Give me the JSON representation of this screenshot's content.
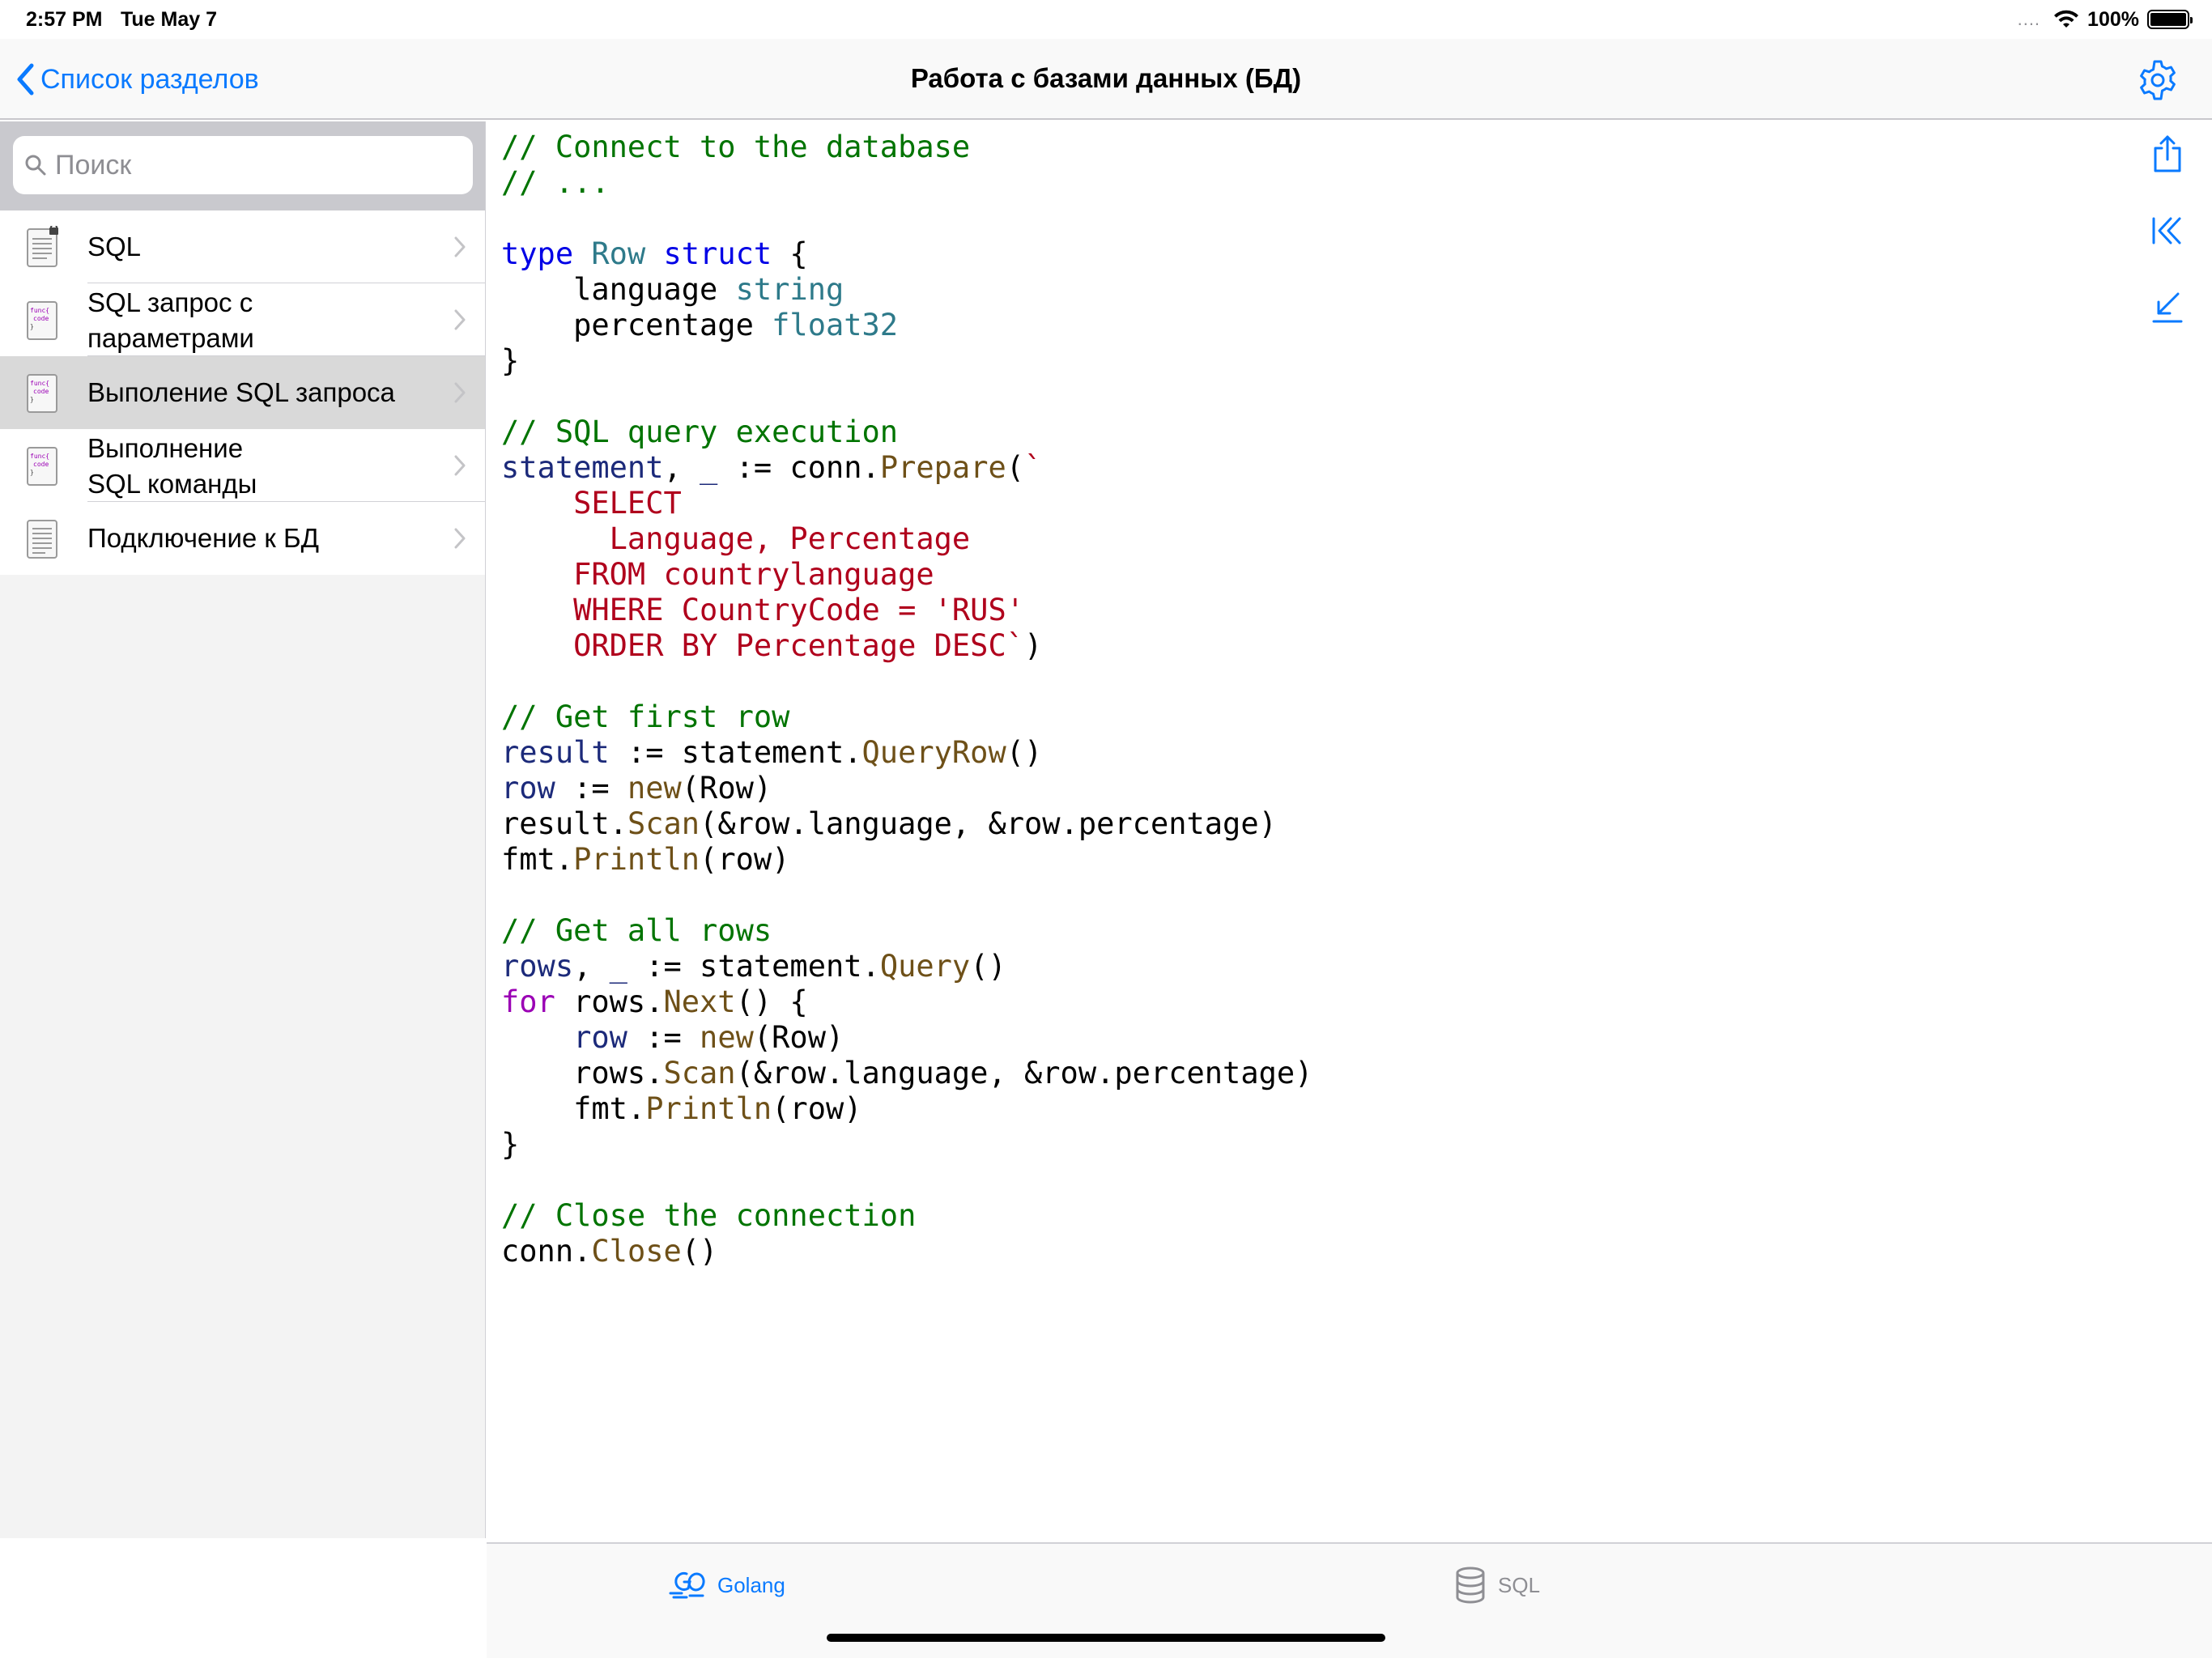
{
  "status_bar": {
    "time": "2:57 PM",
    "date": "Tue May 7",
    "battery": "100%",
    "signal_dots": "....",
    "icons": [
      "wifi-icon",
      "battery-icon"
    ]
  },
  "nav": {
    "back_label": "Список разделов",
    "title": "Работа с базами данных (БД)",
    "accent_color": "#0a7aff"
  },
  "search": {
    "placeholder": "Поиск",
    "value": ""
  },
  "sidebar": {
    "items": [
      {
        "label": "SQL",
        "icon": "locked-document-icon",
        "selected": false
      },
      {
        "label": "SQL запрос с\nпараметрами",
        "icon": "func-code-icon",
        "selected": false
      },
      {
        "label": "Выполение SQL запроса",
        "icon": "func-code-icon",
        "selected": true
      },
      {
        "label": "Выполнение\nSQL команды",
        "icon": "func-code-icon",
        "selected": false
      },
      {
        "label": "Подключение к БД",
        "icon": "document-icon",
        "selected": false
      }
    ]
  },
  "code": {
    "language": "go",
    "text": "// Connect to the database\n// ...\n\ntype Row struct {\n    language string\n    percentage float32\n}\n\n// SQL query execution\nstatement, _ := conn.Prepare(`\n    SELECT\n      Language, Percentage\n    FROM countrylanguage\n    WHERE CountryCode = 'RUS'\n    ORDER BY Percentage DESC`)\n\n// Get first row\nresult := statement.QueryRow()\nrow := new(Row)\nresult.Scan(&row.language, &row.percentage)\nfmt.Println(row)\n\n// Get all rows\nrows, _ := statement.Query()\nfor rows.Next() {\n    row := new(Row)\n    rows.Scan(&row.language, &row.percentage)\n    fmt.Println(row)\n}\n\n// Close the connection\nconn.Close()"
  },
  "toolbar": {
    "icons": [
      "share-icon",
      "jump-to-start-icon",
      "collapse-icon"
    ]
  },
  "tabs": [
    {
      "label": "Golang",
      "icon": "golang-icon",
      "active": true
    },
    {
      "label": "SQL",
      "icon": "database-icon",
      "active": false
    }
  ]
}
